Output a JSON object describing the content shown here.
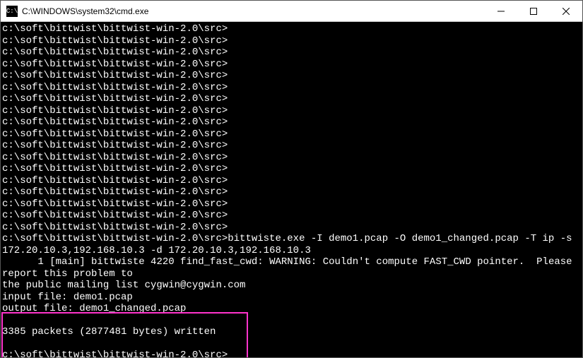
{
  "window": {
    "title": "C:\\WINDOWS\\system32\\cmd.exe",
    "icon_label": "cmd-icon"
  },
  "terminal": {
    "prompt": "c:\\soft\\bittwist\\bittwist-win-2.0\\src>",
    "prompt_repeat_count": 18,
    "command": "bittwiste.exe -I demo1.pcap -O demo1_changed.pcap -T ip -s 172.20.10.3,192.168.10.3 -d 172.20.10.3,192.168.10.3",
    "output_lines": [
      "      1 [main] bittwiste 4220 find_fast_cwd: WARNING: Couldn't compute FAST_CWD pointer.  Please report this problem to",
      "the public mailing list cygwin@cygwin.com",
      "input file: demo1.pcap",
      "output file: demo1_changed.pcap",
      "",
      "3385 packets (2877481 bytes) written",
      ""
    ],
    "final_prompt": "c:\\soft\\bittwist\\bittwist-win-2.0\\src>"
  }
}
